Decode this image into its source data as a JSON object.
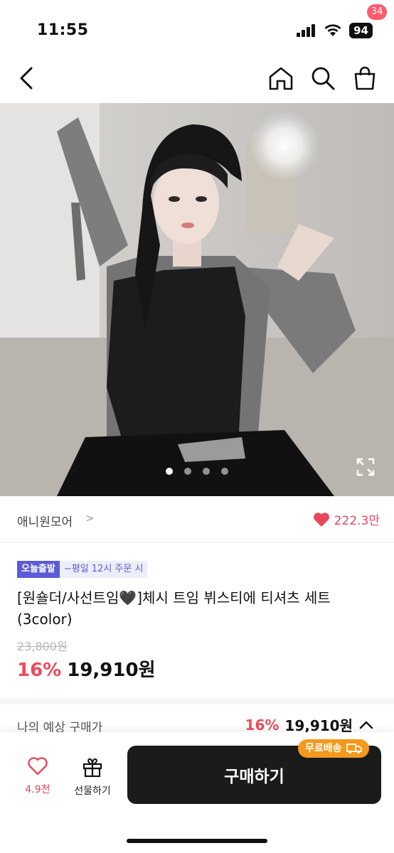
{
  "status_bar": {
    "time": "11:55",
    "battery": "94"
  },
  "nav": {
    "cart_count": "34"
  },
  "gallery": {
    "image_count": 4,
    "active_index": 0
  },
  "store": {
    "name": "애니원모어",
    "chevron": ">",
    "likes": "222.3만"
  },
  "product": {
    "badge_today": "오늘출발",
    "badge_time": "~평일 12시 주문 시",
    "title": "[원숄더/사선트임🖤]체시 트임 뷔스티에 티셔츠 세트 (3color)",
    "original_price": "23,800원",
    "discount": "16%",
    "price": "19,910원"
  },
  "estimate": {
    "label": "나의 예상 구매가",
    "discount": "16%",
    "price": "19,910원"
  },
  "bottom": {
    "wish_count": "4.9천",
    "gift_label": "선물하기",
    "buy_label": "구매하기",
    "free_ship": "무료배송"
  },
  "colors": {
    "accent_pink": "#ef4a5a",
    "badge_purple": "#5b5bd6",
    "free_ship_orange": "#f39a1e"
  }
}
